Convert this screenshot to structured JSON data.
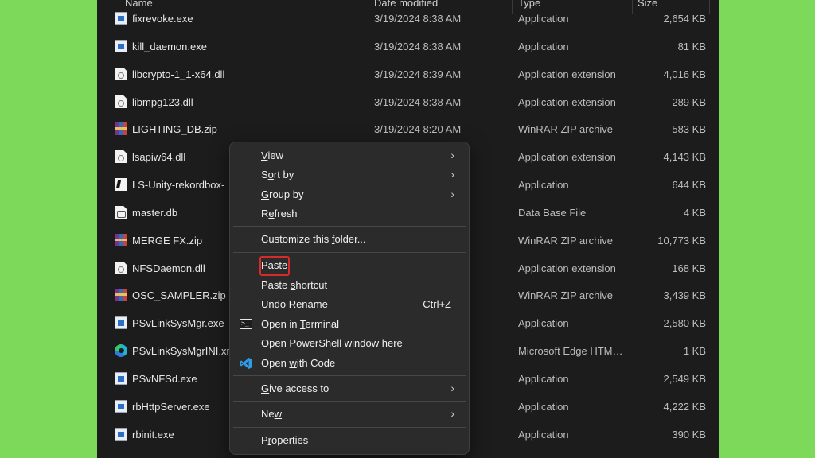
{
  "header": {
    "name": "Name",
    "date": "Date modified",
    "type": "Type",
    "size": "Size"
  },
  "files": [
    {
      "name": "fixrevoke.exe",
      "date": "3/19/2024 8:38 AM",
      "type": "Application",
      "size": "2,654 KB",
      "icon": "exe-icon"
    },
    {
      "name": "kill_daemon.exe",
      "date": "3/19/2024 8:38 AM",
      "type": "Application",
      "size": "81 KB",
      "icon": "exe-icon"
    },
    {
      "name": "libcrypto-1_1-x64.dll",
      "date": "3/19/2024 8:39 AM",
      "type": "Application extension",
      "size": "4,016 KB",
      "icon": "dll-icon"
    },
    {
      "name": "libmpg123.dll",
      "date": "3/19/2024 8:38 AM",
      "type": "Application extension",
      "size": "289 KB",
      "icon": "dll-icon"
    },
    {
      "name": "LIGHTING_DB.zip",
      "date": "3/19/2024 8:20 AM",
      "type": "WinRAR ZIP archive",
      "size": "583 KB",
      "icon": "zip-icon"
    },
    {
      "name": "lsapiw64.dll",
      "date": "",
      "type": "Application extension",
      "size": "4,143 KB",
      "icon": "dll-icon"
    },
    {
      "name": "LS-Unity-rekordbox-",
      "date": "",
      "type": "Application",
      "size": "644 KB",
      "icon": "unity-icon"
    },
    {
      "name": "master.db",
      "date": "",
      "type": "Data Base File",
      "size": "4 KB",
      "icon": "db-icon"
    },
    {
      "name": "MERGE FX.zip",
      "date": "",
      "type": "WinRAR ZIP archive",
      "size": "10,773 KB",
      "icon": "zip-icon"
    },
    {
      "name": "NFSDaemon.dll",
      "date": "",
      "type": "Application extension",
      "size": "168 KB",
      "icon": "dll-icon"
    },
    {
      "name": "OSC_SAMPLER.zip",
      "date": "",
      "type": "WinRAR ZIP archive",
      "size": "3,439 KB",
      "icon": "zip-icon"
    },
    {
      "name": "PSvLinkSysMgr.exe",
      "date": "",
      "type": "Application",
      "size": "2,580 KB",
      "icon": "exe-icon"
    },
    {
      "name": "PSvLinkSysMgrINI.xm",
      "date": "",
      "type": "Microsoft Edge HTM…",
      "size": "1 KB",
      "icon": "edge-icon"
    },
    {
      "name": "PSvNFSd.exe",
      "date": "",
      "type": "Application",
      "size": "2,549 KB",
      "icon": "exe-icon"
    },
    {
      "name": "rbHttpServer.exe",
      "date": "",
      "type": "Application",
      "size": "4,222 KB",
      "icon": "exe-icon"
    },
    {
      "name": "rbinit.exe",
      "date": "",
      "type": "Application",
      "size": "390 KB",
      "icon": "exe-icon"
    }
  ],
  "context_menu": {
    "view": {
      "pre": "",
      "key": "V",
      "post": "iew"
    },
    "sort_by": {
      "pre": "S",
      "key": "o",
      "post": "rt by"
    },
    "group_by": {
      "pre": "",
      "key": "G",
      "post": "roup by"
    },
    "refresh": {
      "pre": "R",
      "key": "e",
      "post": "fresh"
    },
    "customize": {
      "pre": "Customize this ",
      "key": "f",
      "post": "older..."
    },
    "paste": {
      "pre": "",
      "key": "P",
      "post": "aste"
    },
    "paste_shortcut": {
      "pre": "Paste ",
      "key": "s",
      "post": "hortcut"
    },
    "undo_rename": {
      "pre": "",
      "key": "U",
      "post": "ndo Rename"
    },
    "undo_shortcut": "Ctrl+Z",
    "open_terminal": {
      "pre": "Open in ",
      "key": "T",
      "post": "erminal"
    },
    "open_powershell": "Open PowerShell window here",
    "open_code": {
      "pre": "Open ",
      "key": "w",
      "post": "ith Code"
    },
    "give_access": {
      "pre": "",
      "key": "G",
      "post": "ive access to"
    },
    "new": {
      "pre": "Ne",
      "key": "w",
      "post": ""
    },
    "properties": {
      "pre": "P",
      "key": "r",
      "post": "operties"
    }
  },
  "colors": {
    "background": "#7dd95a",
    "panel": "#1c1c1c",
    "menu": "#2b2b2b",
    "highlight": "#d72a2a"
  }
}
